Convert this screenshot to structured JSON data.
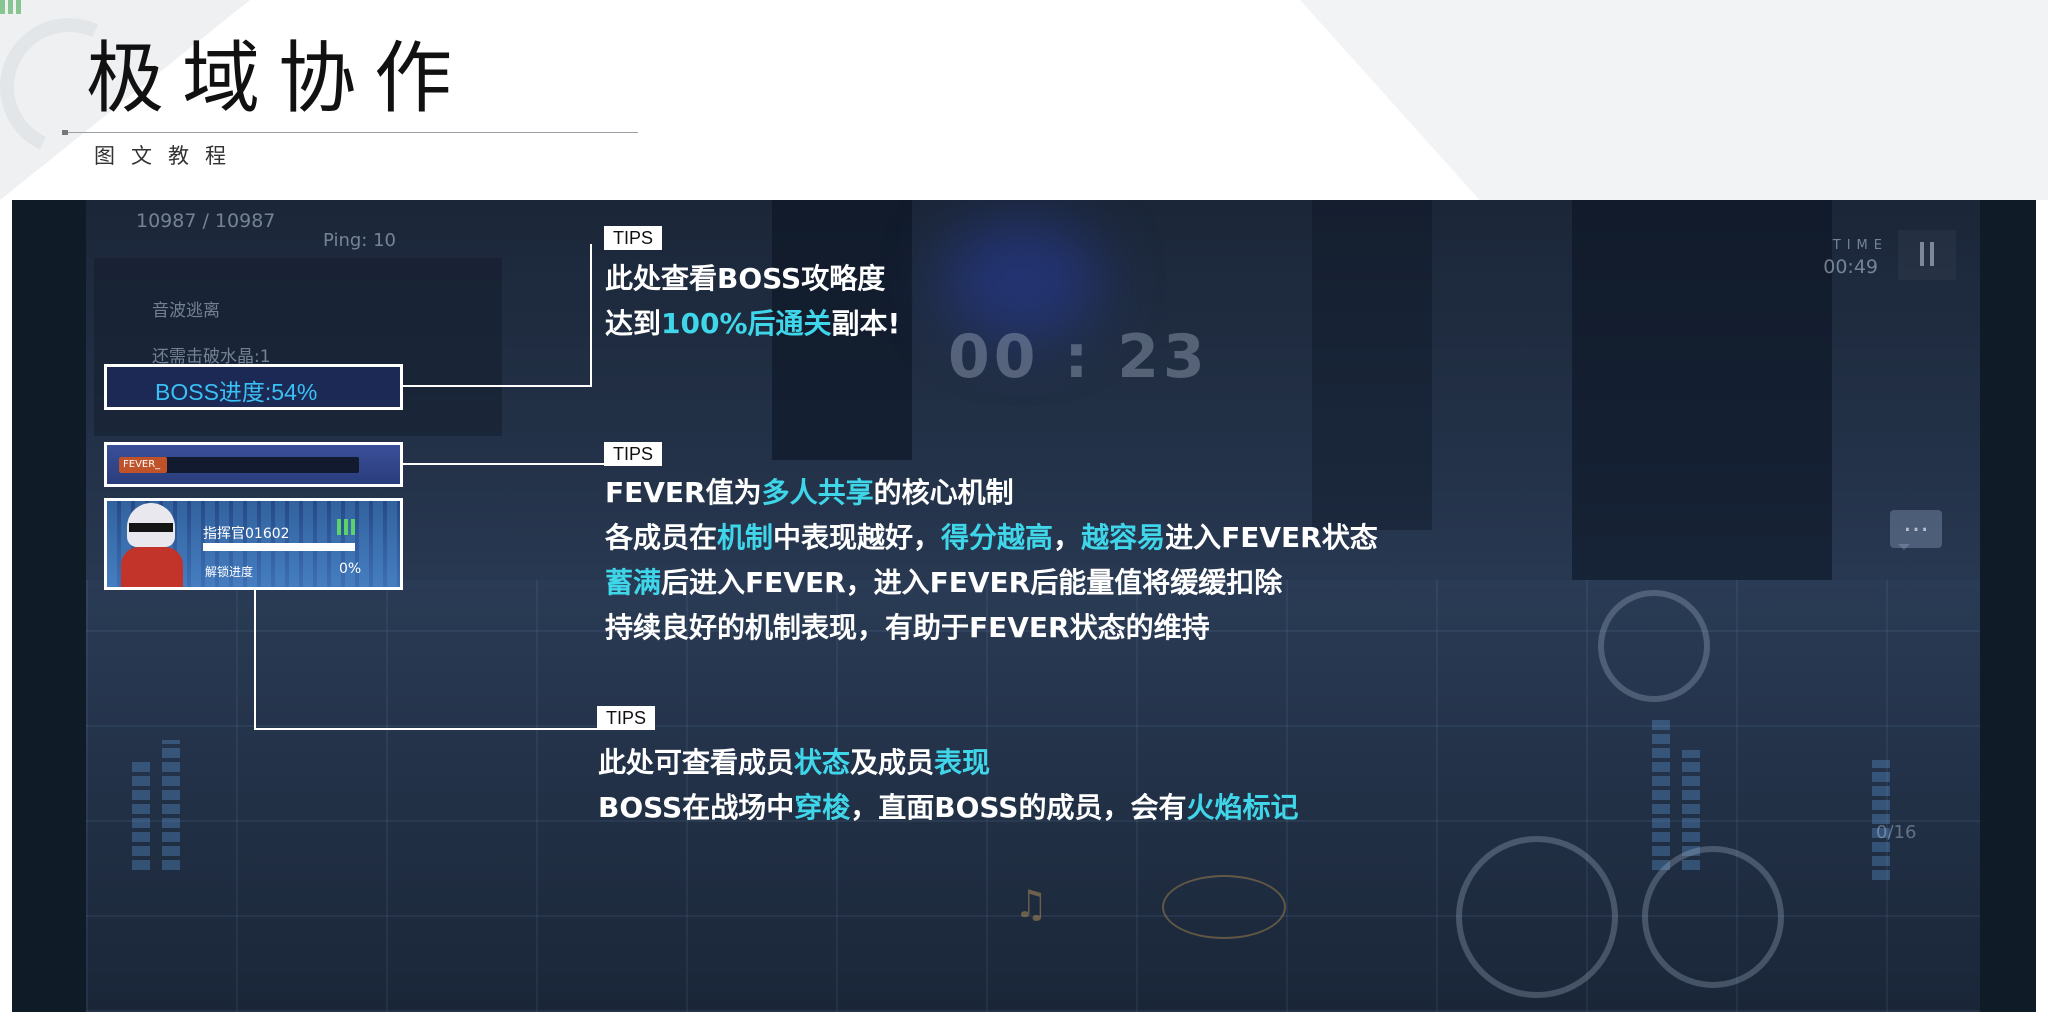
{
  "header": {
    "title": "极域协作",
    "subtitle": "图文教程"
  },
  "hud": {
    "hp": "10987 / 10987",
    "ping": "Ping: 10",
    "task_1": "音波逃离",
    "task_2": "还需击破水晶:1",
    "time_label": "TIME",
    "time_value": "00:49",
    "countdown": "00 : 23",
    "chat_glyph": "…",
    "counter": "0/16",
    "note_glyph": "♫"
  },
  "highlights": {
    "boss_progress": "BOSS进度:54%",
    "fever_chip": "FEVER_",
    "member_name": "指挥官01602",
    "member_unlock_label": "解锁进度",
    "member_unlock_value": "0%"
  },
  "tips": [
    {
      "label": "TIPS",
      "lines": [
        [
          {
            "text": "此处查看BOSS攻略度",
            "hl": false
          }
        ],
        [
          {
            "text": "达到",
            "hl": false
          },
          {
            "text": "100%后通关",
            "hl": true
          },
          {
            "text": "副本!",
            "hl": false
          }
        ]
      ]
    },
    {
      "label": "TIPS",
      "lines": [
        [
          {
            "text": "FEVER值为",
            "hl": false
          },
          {
            "text": "多人共享",
            "hl": true
          },
          {
            "text": "的核心机制",
            "hl": false
          }
        ],
        [
          {
            "text": "各成员在",
            "hl": false
          },
          {
            "text": "机制",
            "hl": true
          },
          {
            "text": "中表现越好，",
            "hl": false
          },
          {
            "text": "得分越高",
            "hl": true
          },
          {
            "text": "，",
            "hl": false
          },
          {
            "text": "越容易",
            "hl": true
          },
          {
            "text": "进入FEVER状态",
            "hl": false
          }
        ],
        [
          {
            "text": "蓄满",
            "hl": true
          },
          {
            "text": "后进入FEVER，进入FEVER后能量值将缓缓扣除",
            "hl": false
          }
        ],
        [
          {
            "text": "持续良好的机制表现，有助于FEVER状态的维持",
            "hl": false
          }
        ]
      ]
    },
    {
      "label": "TIPS",
      "lines": [
        [
          {
            "text": "此处可查看成员",
            "hl": false
          },
          {
            "text": "状态",
            "hl": true
          },
          {
            "text": "及成员",
            "hl": false
          },
          {
            "text": "表现",
            "hl": true
          }
        ],
        [
          {
            "text": "BOSS在战场中",
            "hl": false
          },
          {
            "text": "穿梭",
            "hl": true
          },
          {
            "text": "，直面BOSS的成员，会有",
            "hl": false
          },
          {
            "text": "火焰标记",
            "hl": true
          }
        ]
      ]
    }
  ],
  "colors": {
    "highlight": "#3fd6ea",
    "boss_text": "#39c1f6",
    "game_bg": "#24334a"
  }
}
